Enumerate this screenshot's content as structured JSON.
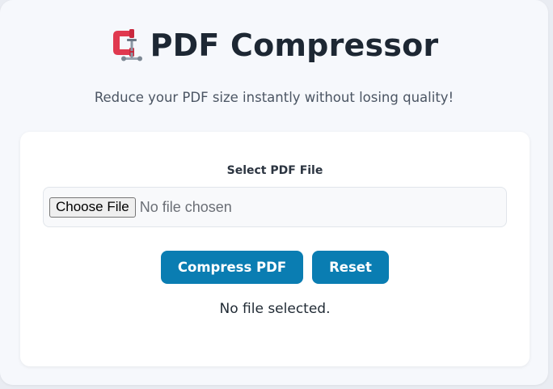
{
  "header": {
    "title": "PDF Compressor",
    "icon": "clamp-icon",
    "subtitle": "Reduce your PDF size instantly without losing quality!"
  },
  "form": {
    "label": "Select PDF File",
    "choose_button": "Choose File",
    "file_status": "No file chosen"
  },
  "actions": {
    "compress_label": "Compress PDF",
    "reset_label": "Reset"
  },
  "status_message": "No file selected.",
  "colors": {
    "accent": "#0a7db2",
    "title": "#1d2733",
    "background": "#f6f8fc",
    "icon_red": "#e0394f"
  }
}
